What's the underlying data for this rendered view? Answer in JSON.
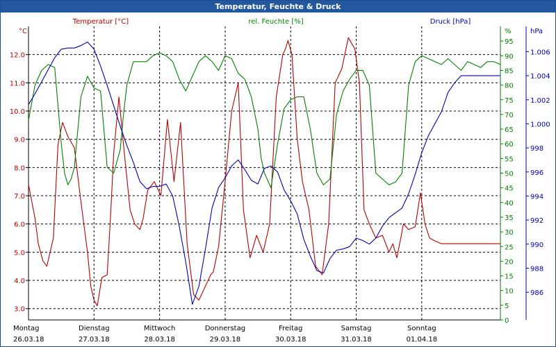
{
  "window": {
    "title": "Temperatur, Feuchte & Druck"
  },
  "colors": {
    "temperature": "#b30000",
    "humidity": "#008000",
    "pressure": "#0000b3",
    "title_bg": "#23579e",
    "grid": "#000000"
  },
  "chart_data": {
    "type": "line",
    "grid": true,
    "axes": {
      "left": {
        "unit": "°C",
        "label": "Temperatur [°C]",
        "range": [
          2.6,
          13.0
        ],
        "ticks": [
          "3.0",
          "4.0",
          "5.0",
          "6.0",
          "7.0",
          "8.0",
          "9.0",
          "10.0",
          "11.0",
          "12.0"
        ]
      },
      "mid": {
        "unit": "%",
        "label": "rel. Feuchte [%]",
        "range": [
          0,
          100
        ],
        "ticks": [
          "0",
          "5",
          "10",
          "15",
          "20",
          "25",
          "30",
          "35",
          "40",
          "45",
          "50",
          "55",
          "60",
          "65",
          "70",
          "75",
          "80",
          "85",
          "90",
          "95",
          "%"
        ]
      },
      "right": {
        "unit": "hPa",
        "label": "Druck [hPa]",
        "range": [
          983.7,
          1008.1
        ],
        "ticks": [
          "986",
          "988",
          "990",
          "992",
          "994",
          "996",
          "998",
          "1.000",
          "1.002",
          "1.004",
          "1.006"
        ]
      }
    },
    "x_range": [
      0,
      7.2
    ],
    "days": [
      {
        "day": "Montag",
        "date": "26.03.18"
      },
      {
        "day": "Dienstag",
        "date": "27.03.18"
      },
      {
        "day": "Mittwoch",
        "date": "28.03.18"
      },
      {
        "day": "Donnerstag",
        "date": "29.03.18"
      },
      {
        "day": "Freitag",
        "date": "30.03.18"
      },
      {
        "day": "Samstag",
        "date": "31.03.18"
      },
      {
        "day": "Sonntag",
        "date": "01.04.18"
      }
    ],
    "series": [
      {
        "name": "Temperatur [°C]",
        "axis": "left",
        "x": [
          0.0,
          0.1,
          0.15,
          0.22,
          0.28,
          0.38,
          0.45,
          0.52,
          0.6,
          0.7,
          0.8,
          0.9,
          0.95,
          1.0,
          1.05,
          1.12,
          1.2,
          1.25,
          1.3,
          1.38,
          1.45,
          1.55,
          1.62,
          1.7,
          1.75,
          1.82,
          1.92,
          2.02,
          2.12,
          2.22,
          2.32,
          2.42,
          2.52,
          2.6,
          2.7,
          2.78,
          2.82,
          2.9,
          3.0,
          3.1,
          3.2,
          3.28,
          3.38,
          3.48,
          3.58,
          3.68,
          3.78,
          3.88,
          3.92,
          3.96,
          4.02,
          4.1,
          4.18,
          4.28,
          4.38,
          4.48,
          4.58,
          4.68,
          4.78,
          4.88,
          4.98,
          5.05,
          5.12,
          5.2,
          5.3,
          5.4,
          5.5,
          5.56,
          5.62,
          5.68,
          5.72,
          5.8,
          5.9,
          5.98,
          6.05,
          6.12,
          6.2,
          6.3,
          6.4,
          6.5,
          6.55,
          6.62,
          6.7,
          6.75,
          6.82,
          6.9,
          6.95,
          7.0,
          7.05,
          7.1,
          7.2
        ],
        "y": [
          7.4,
          6.2,
          5.3,
          4.7,
          4.5,
          5.5,
          8.8,
          9.6,
          9.1,
          8.7,
          6.8,
          5.0,
          3.8,
          3.3,
          3.1,
          4.1,
          4.2,
          6.2,
          8.5,
          10.5,
          8.8,
          6.5,
          6.0,
          5.8,
          6.2,
          7.2,
          7.5,
          7.0,
          9.7,
          7.5,
          9.6,
          5.3,
          3.5,
          3.3,
          3.8,
          4.2,
          4.3,
          5.2,
          7.5,
          10.0,
          11.0,
          6.5,
          4.8,
          5.6,
          5.0,
          6.0,
          10.5,
          12.0,
          12.2,
          12.5,
          12.0,
          9.0,
          7.5,
          6.5,
          4.5,
          4.2,
          6.0,
          11.0,
          11.5,
          12.6,
          12.2,
          11.0,
          6.5,
          6.0,
          5.5,
          5.6,
          5.0,
          5.3,
          4.8,
          5.5,
          6.0,
          5.8,
          5.9,
          7.1,
          6.0,
          5.5,
          5.4,
          5.3,
          5.3,
          5.3,
          5.3,
          5.3,
          5.3,
          5.3,
          5.3,
          5.3,
          5.3,
          5.3,
          5.3,
          5.3,
          5.3
        ]
      },
      {
        "name": "rel. Feuchte [%]",
        "axis": "mid",
        "x": [
          0.0,
          0.1,
          0.2,
          0.3,
          0.4,
          0.5,
          0.55,
          0.6,
          0.65,
          0.7,
          0.8,
          0.9,
          1.0,
          1.1,
          1.2,
          1.3,
          1.4,
          1.45,
          1.5,
          1.6,
          1.7,
          1.8,
          1.9,
          2.0,
          2.1,
          2.2,
          2.3,
          2.4,
          2.5,
          2.6,
          2.7,
          2.8,
          2.9,
          3.0,
          3.1,
          3.2,
          3.3,
          3.4,
          3.5,
          3.55,
          3.6,
          3.7,
          3.8,
          3.9,
          4.0,
          4.1,
          4.2,
          4.3,
          4.4,
          4.5,
          4.6,
          4.7,
          4.8,
          4.9,
          5.0,
          5.1,
          5.2,
          5.3,
          5.4,
          5.5,
          5.6,
          5.7,
          5.8,
          5.9,
          6.0,
          6.1,
          6.2,
          6.3,
          6.4,
          6.5,
          6.6,
          6.7,
          6.8,
          6.9,
          7.0,
          7.1,
          7.2
        ],
        "y": [
          68,
          80,
          85,
          87,
          86,
          60,
          50,
          46,
          48,
          52,
          76,
          83,
          79,
          78,
          52,
          50,
          58,
          70,
          80,
          88,
          88,
          88,
          90,
          91,
          90,
          88,
          82,
          78,
          83,
          88,
          90,
          88,
          85,
          90,
          89,
          84,
          82,
          76,
          65,
          55,
          50,
          45,
          60,
          72,
          75,
          76,
          76,
          65,
          50,
          46,
          48,
          70,
          78,
          82,
          85,
          85,
          80,
          50,
          48,
          46,
          47,
          50,
          80,
          88,
          90,
          89,
          88,
          87,
          89,
          87,
          85,
          88,
          87,
          86,
          88,
          88,
          87
        ]
      },
      {
        "name": "Druck [hPa]",
        "axis": "right",
        "x": [
          0.0,
          0.1,
          0.2,
          0.3,
          0.4,
          0.5,
          0.6,
          0.7,
          0.8,
          0.9,
          1.0,
          1.1,
          1.2,
          1.3,
          1.4,
          1.5,
          1.6,
          1.7,
          1.8,
          1.9,
          2.0,
          2.1,
          2.2,
          2.3,
          2.4,
          2.5,
          2.6,
          2.7,
          2.8,
          2.9,
          3.0,
          3.1,
          3.2,
          3.3,
          3.4,
          3.5,
          3.6,
          3.7,
          3.8,
          3.9,
          4.0,
          4.1,
          4.2,
          4.3,
          4.4,
          4.5,
          4.6,
          4.7,
          4.8,
          4.9,
          5.0,
          5.1,
          5.2,
          5.3,
          5.4,
          5.5,
          5.6,
          5.7,
          5.8,
          5.9,
          6.0,
          6.1,
          6.2,
          6.3,
          6.4,
          6.5,
          6.6,
          6.7,
          6.8,
          6.9,
          7.0,
          7.1,
          7.2
        ],
        "y": [
          1001.6,
          1002.5,
          1003.5,
          1004.5,
          1005.5,
          1006.2,
          1006.3,
          1006.3,
          1006.5,
          1006.8,
          1006.2,
          1004.8,
          1003.2,
          1001.5,
          999.8,
          998.2,
          996.8,
          995.2,
          994.6,
          994.8,
          994.8,
          995.0,
          994.0,
          991.5,
          988.5,
          985.0,
          986.5,
          989.6,
          993.0,
          994.7,
          995.5,
          996.5,
          997.0,
          996.2,
          995.3,
          995.0,
          996.3,
          996.5,
          996.0,
          994.5,
          993.6,
          992.5,
          990.4,
          989.0,
          987.8,
          987.6,
          988.8,
          989.5,
          989.6,
          989.8,
          990.5,
          990.3,
          990.0,
          990.5,
          991.5,
          992.2,
          992.6,
          993.0,
          994.2,
          995.8,
          997.6,
          999.0,
          1000.0,
          1001.0,
          1002.6,
          1003.4,
          1004.0,
          1004.0,
          1004.0,
          1004.0,
          1004.0,
          1004.0,
          1004.0
        ]
      }
    ]
  }
}
